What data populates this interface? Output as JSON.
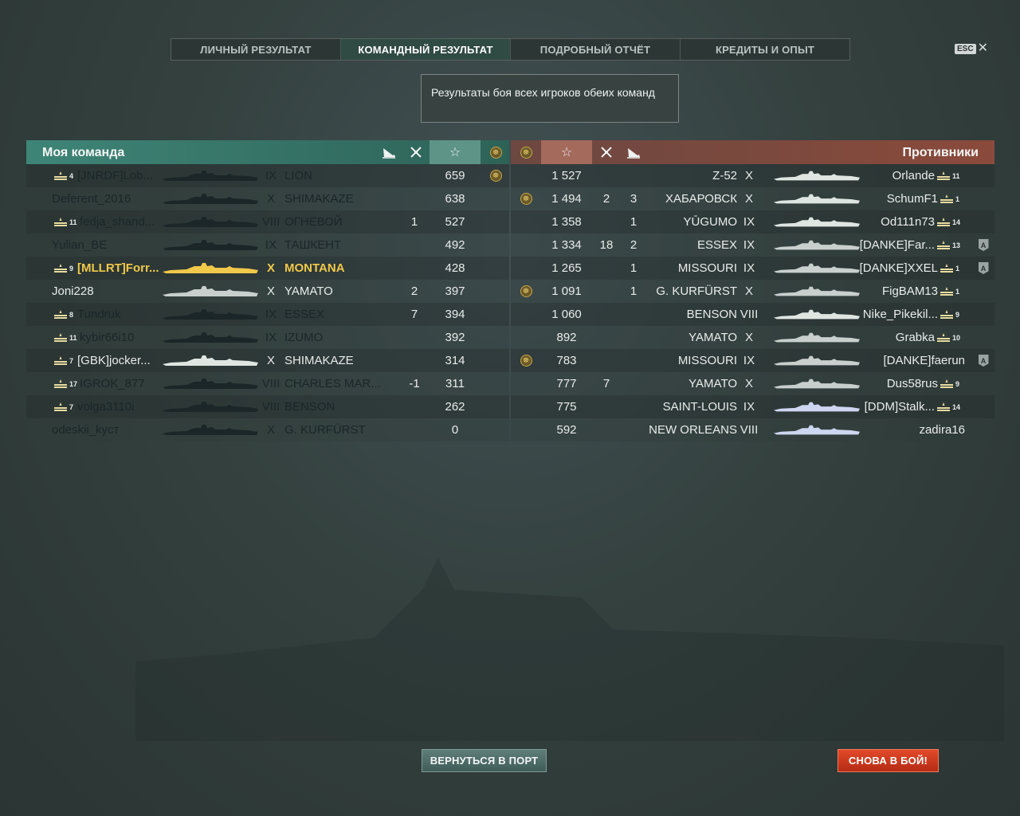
{
  "tabs": [
    {
      "label": "ЛИЧНЫЙ РЕЗУЛЬТАТ",
      "active": false
    },
    {
      "label": "КОМАНДНЫЙ РЕЗУЛЬТАТ",
      "active": true
    },
    {
      "label": "ПОДРОБНЫЙ ОТЧЁТ",
      "active": false
    },
    {
      "label": "КРЕДИТЫ И ОПЫТ",
      "active": false
    }
  ],
  "esc_label": "ESC",
  "tooltip": "Результаты боя всех игроков обеих команд",
  "my_team": {
    "title": "Моя команда",
    "header_icons": [
      "planes-shot-icon",
      "frags-icon",
      "star-icon",
      "medal-icon"
    ],
    "rows": [
      {
        "rank": "4",
        "player": "[JNRDF]Lob...",
        "tier": "IX",
        "ship": "LION",
        "planes": "",
        "frags": "",
        "exp": "659",
        "medal": true,
        "state": "dead",
        "ship_color": "#1a2628"
      },
      {
        "rank": "",
        "player": "Deferent_2016",
        "tier": "X",
        "ship": "SHIMAKAZE",
        "planes": "",
        "frags": "",
        "exp": "638",
        "medal": false,
        "state": "dead",
        "ship_color": "#1a2628"
      },
      {
        "rank": "11",
        "player": "fedja_shand...",
        "tier": "VIII",
        "ship": "ОГНЕВОЙ",
        "planes": "",
        "frags": "1",
        "exp": "527",
        "medal": false,
        "state": "dead",
        "ship_color": "#1a2628"
      },
      {
        "rank": "",
        "player": "Yulian_BE",
        "tier": "IX",
        "ship": "ТАШКЕНТ",
        "planes": "",
        "frags": "",
        "exp": "492",
        "medal": false,
        "state": "dead",
        "ship_color": "#1a2628"
      },
      {
        "rank": "9",
        "player": "[MLLRT]Forr...",
        "tier": "X",
        "ship": "MONTANA",
        "planes": "",
        "frags": "",
        "exp": "428",
        "medal": false,
        "state": "self",
        "ship_color": "#f0c84a"
      },
      {
        "rank": "",
        "player": "Joni228",
        "tier": "X",
        "ship": "YAMATO",
        "planes": "",
        "frags": "2",
        "exp": "397",
        "medal": false,
        "state": "alive",
        "ship_color": "#c8cfcd"
      },
      {
        "rank": "8",
        "player": "Tundruk",
        "tier": "IX",
        "ship": "ESSEX",
        "planes": "",
        "frags": "7",
        "exp": "394",
        "medal": false,
        "state": "dead",
        "ship_color": "#1a2628"
      },
      {
        "rank": "11",
        "player": "kybir66i10",
        "tier": "IX",
        "ship": "IZUMO",
        "planes": "",
        "frags": "",
        "exp": "392",
        "medal": false,
        "state": "dead",
        "ship_color": "#1a2628"
      },
      {
        "rank": "7",
        "player": "[GBK]jocker...",
        "tier": "X",
        "ship": "SHIMAKAZE",
        "planes": "",
        "frags": "",
        "exp": "314",
        "medal": false,
        "state": "alive",
        "ship_color": "#dfe6e2"
      },
      {
        "rank": "17",
        "player": "IGROK_877",
        "tier": "VIII",
        "ship": "CHARLES MAR...",
        "planes": "",
        "frags": "-1",
        "exp": "311",
        "medal": false,
        "state": "dead",
        "ship_color": "#1a2628"
      },
      {
        "rank": "7",
        "player": "volga3110i",
        "tier": "VIII",
        "ship": "BENSON",
        "planes": "",
        "frags": "",
        "exp": "262",
        "medal": false,
        "state": "dead",
        "ship_color": "#1a2628"
      },
      {
        "rank": "",
        "player": "odeskii_kycт",
        "tier": "X",
        "ship": "G. KURFÜRST",
        "planes": "",
        "frags": "",
        "exp": "0",
        "medal": false,
        "state": "dead",
        "ship_color": "#1a2628"
      }
    ]
  },
  "enemy_team": {
    "title": "Противники",
    "header_icons": [
      "medal-icon",
      "star-icon",
      "frags-icon",
      "planes-shot-icon"
    ],
    "rows": [
      {
        "medal": false,
        "exp": "1 527",
        "frags": "",
        "planes": "",
        "ship": "Z-52",
        "tier": "X",
        "player": "Orlande",
        "rank": "11",
        "div": false,
        "ship_color": "#dfe6e2"
      },
      {
        "medal": true,
        "exp": "1 494",
        "frags": "2",
        "planes": "3",
        "ship": "ХАБАРОВСК",
        "tier": "X",
        "player": "SchumF1",
        "rank": "1",
        "div": false,
        "ship_color": "#dfe6e2"
      },
      {
        "medal": false,
        "exp": "1 358",
        "frags": "",
        "planes": "1",
        "ship": "YŪGUMO",
        "tier": "IX",
        "player": "Od111n73",
        "rank": "14",
        "div": false,
        "ship_color": "#dfe6e2"
      },
      {
        "medal": false,
        "exp": "1 334",
        "frags": "18",
        "planes": "2",
        "ship": "ESSEX",
        "tier": "IX",
        "player": "[DANKE]Far...",
        "rank": "13",
        "div": true,
        "ship_color": "#c8cfcd"
      },
      {
        "medal": false,
        "exp": "1 265",
        "frags": "",
        "planes": "1",
        "ship": "MISSOURI",
        "tier": "IX",
        "player": "[DANKE]XXEL",
        "rank": "1",
        "div": true,
        "ship_color": "#c8cfcd"
      },
      {
        "medal": true,
        "exp": "1 091",
        "frags": "",
        "planes": "1",
        "ship": "G. KURFÜRST",
        "tier": "X",
        "player": "FigBAM13",
        "rank": "1",
        "div": false,
        "ship_color": "#c8cfcd"
      },
      {
        "medal": false,
        "exp": "1 060",
        "frags": "",
        "planes": "",
        "ship": "BENSON",
        "tier": "VIII",
        "player": "Nike_Pikekil...",
        "rank": "9",
        "div": false,
        "ship_color": "#dfe6e2"
      },
      {
        "medal": false,
        "exp": "892",
        "frags": "",
        "planes": "",
        "ship": "YAMATO",
        "tier": "X",
        "player": "Grabka",
        "rank": "10",
        "div": false,
        "ship_color": "#c8cfcd"
      },
      {
        "medal": true,
        "exp": "783",
        "frags": "",
        "planes": "",
        "ship": "MISSOURI",
        "tier": "IX",
        "player": "[DANKE]faerun",
        "rank": "",
        "div": true,
        "ship_color": "#c8cfcd"
      },
      {
        "medal": false,
        "exp": "777",
        "frags": "7",
        "planes": "",
        "ship": "YAMATO",
        "tier": "X",
        "player": "Dus58rus",
        "rank": "9",
        "div": false,
        "ship_color": "#c8cfcd"
      },
      {
        "medal": false,
        "exp": "775",
        "frags": "",
        "planes": "",
        "ship": "SAINT-LOUIS",
        "tier": "IX",
        "player": "[DDM]Stalk...",
        "rank": "14",
        "div": false,
        "ship_color": "#cdd6f0"
      },
      {
        "medal": false,
        "exp": "592",
        "frags": "",
        "planes": "",
        "ship": "NEW ORLEANS",
        "tier": "VIII",
        "player": "zadira16",
        "rank": "",
        "div": false,
        "ship_color": "#cdd6f0"
      }
    ]
  },
  "buttons": {
    "port": "ВЕРНУТЬСЯ В ПОРТ",
    "battle": "СНОВА В БОЙ!"
  }
}
